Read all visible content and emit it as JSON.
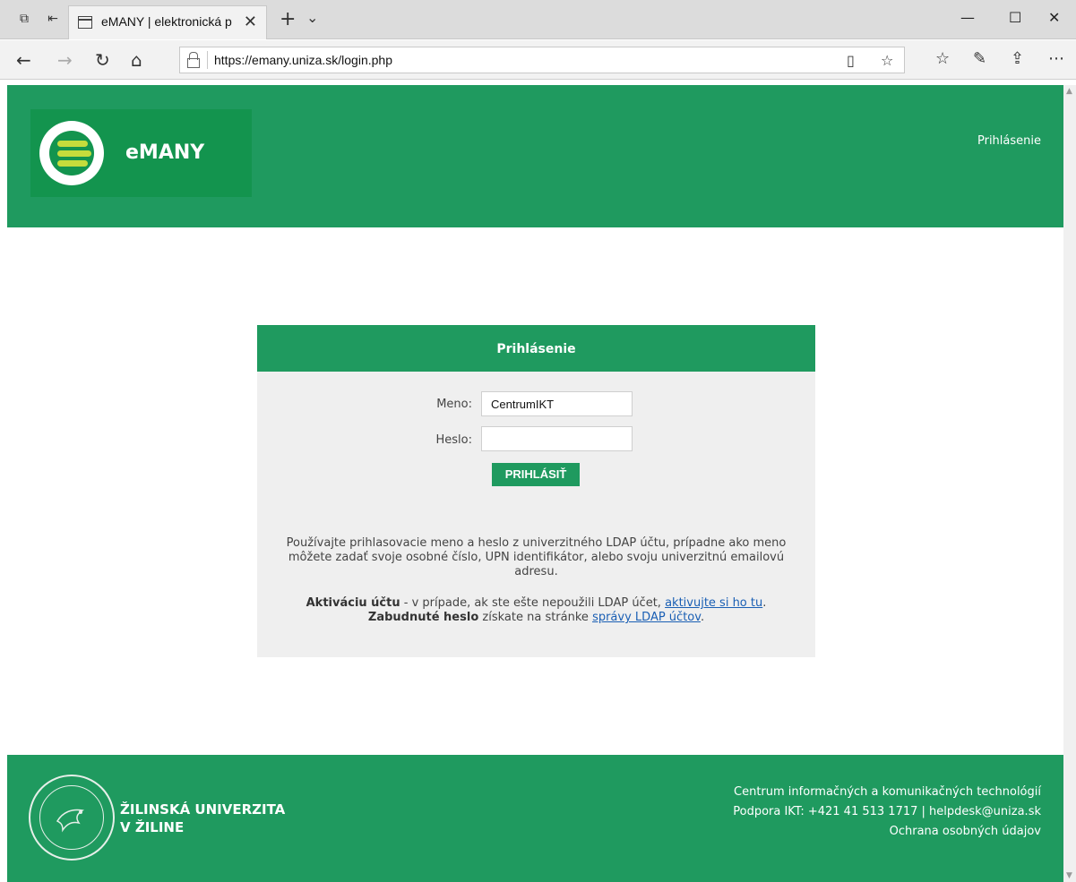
{
  "browser": {
    "tab_title": "eMANY | elektronická p",
    "url_prefix": "https://",
    "url_host": "emany.uniza.sk",
    "url_path": "/login.php"
  },
  "header": {
    "logo_text": "eMANY",
    "nav_link": "Prihlásenie"
  },
  "login": {
    "title": "Prihlásenie",
    "username_label": "Meno:",
    "username_value": "CentrumIKT",
    "password_label": "Heslo:",
    "password_value": "",
    "submit_label": "PRIHLÁSIŤ",
    "info_text": "Používajte prihlasovacie meno a heslo z univerzitného LDAP účtu, prípadne ako meno môžete zadať svoje osobné číslo, UPN identifikátor, alebo svoju univerzitnú emailovú adresu.",
    "activation_bold": "Aktiváciu účtu",
    "activation_text": " - v prípade, ak ste ešte nepoužili LDAP účet, ",
    "activation_link": "aktivujte si ho tu",
    "activation_end": ".",
    "forgot_bold": "Zabudnuté heslo",
    "forgot_text": " získate na stránke ",
    "forgot_link": "správy LDAP účtov",
    "forgot_end": "."
  },
  "footer": {
    "university_line1": "ŽILINSKÁ UNIVERZITA",
    "university_line2": "V ŽILINE",
    "center_name": "Centrum informačných a komunikačných technológií",
    "support": "Podpora IKT: +421 41 513 1717 | helpdesk@uniza.sk",
    "privacy_link": "Ochrana osobných údajov"
  },
  "colors": {
    "brand_green": "#1f9a5f",
    "logo_accent": "#c5dc3c",
    "link_blue": "#1a5fb4"
  }
}
